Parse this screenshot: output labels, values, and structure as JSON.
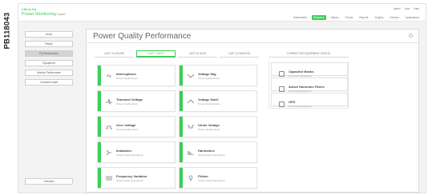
{
  "side_code": "PB118043",
  "header": {
    "brand_top": "Life Is On",
    "brand_app": "Power Monitoring",
    "brand_expert": "Expert",
    "utility_links": [
      "Admin",
      "User",
      "Help"
    ],
    "nav": [
      {
        "label": "Dashboards",
        "active": false
      },
      {
        "label": "Diagrams",
        "active": true
      },
      {
        "label": "Alarms",
        "active": false
      },
      {
        "label": "Trends",
        "active": false
      },
      {
        "label": "Reports",
        "active": false
      },
      {
        "label": "Insights",
        "active": false
      },
      {
        "label": "Devices",
        "active": false
      },
      {
        "label": "Applications",
        "active": false
      }
    ]
  },
  "sidebar": {
    "items": [
      {
        "label": "Home",
        "active": false
      },
      {
        "label": "Feeder",
        "active": false
      },
      {
        "label": "PQ Performance",
        "active": true
      },
      {
        "label": "Equipment",
        "active": false
      },
      {
        "label": "Monitor Performance",
        "active": false
      },
      {
        "label": "Customer Audit",
        "active": false
      }
    ],
    "bottom": "Overview"
  },
  "panel": {
    "title": "Power Quality Performance",
    "tabs": [
      {
        "label": "LAST 24 HOURS",
        "active": false
      },
      {
        "label": "LAST 7 DAYS",
        "active": true
      },
      {
        "label": "LAST 30 DAYS",
        "active": false
      },
      {
        "label": "LAST 12 MONTHS",
        "active": false
      }
    ],
    "corrective_header": "CORRECTIVE EQUIPMENT STATUS",
    "cards_left": [
      {
        "title": "Interruptions",
        "sub": "Power Quality Event",
        "icon": "interruption-icon"
      },
      {
        "title": "Transient Voltage",
        "sub": "Power Quality Event",
        "icon": "transient-icon"
      },
      {
        "title": "Over Voltage",
        "sub": "Power Quality Event",
        "icon": "over-voltage-icon"
      },
      {
        "title": "Imbalance",
        "sub": "Steady State Disturbance",
        "icon": "imbalance-icon"
      },
      {
        "title": "Frequency Variation",
        "sub": "Steady State Disturbance",
        "icon": "frequency-icon"
      }
    ],
    "cards_mid": [
      {
        "title": "Voltage Sag",
        "sub": "Power Quality Event",
        "icon": "sag-icon"
      },
      {
        "title": "Voltage Swell",
        "sub": "Power Quality Event",
        "icon": "swell-icon"
      },
      {
        "title": "Under Voltage",
        "sub": "Power Quality Event",
        "icon": "under-voltage-icon"
      },
      {
        "title": "Harmonics",
        "sub": "Steady State Disturbance",
        "icon": "harmonics-icon"
      },
      {
        "title": "Flicker",
        "sub": "Steady State Disturbance",
        "icon": "flicker-icon"
      }
    ],
    "cards_corrective": [
      {
        "title": "Capacitor Banks",
        "sub": "Corrective Equipment"
      },
      {
        "title": "Active Harmonic Filters",
        "sub": "Corrective Equipment"
      },
      {
        "title": "UPS",
        "sub": "Corrective Equipment"
      }
    ]
  },
  "colors": {
    "accent": "#3dcd58"
  }
}
